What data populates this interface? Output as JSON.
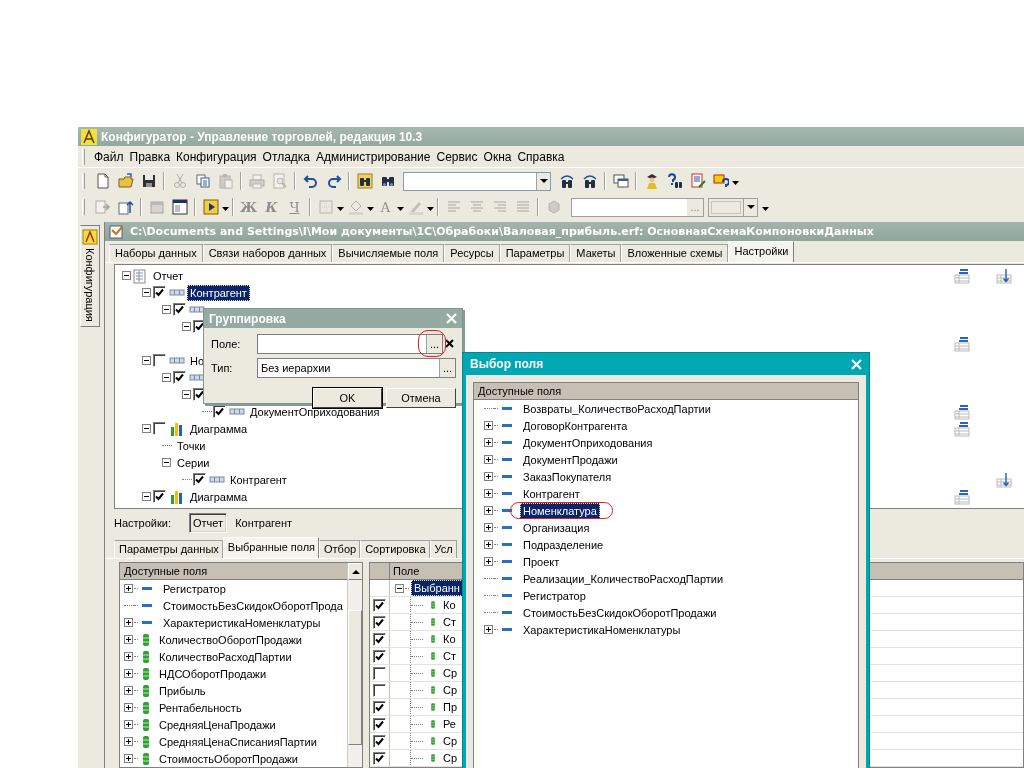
{
  "app_window": {
    "title": "Конфигуратор - Управление торговлей, редакция 10.3"
  },
  "menu": [
    "Файл",
    "Правка",
    "Конфигурация",
    "Отладка",
    "Администрирование",
    "Сервис",
    "Окна",
    "Справка"
  ],
  "toolbars": [
    [
      {
        "kind": "new",
        "disabled": false
      },
      {
        "kind": "open",
        "disabled": false
      },
      {
        "kind": "save",
        "disabled": false
      },
      {
        "kind": "sep"
      },
      {
        "kind": "cut",
        "disabled": true
      },
      {
        "kind": "copy",
        "disabled": false
      },
      {
        "kind": "paste",
        "disabled": true
      },
      {
        "kind": "sep"
      },
      {
        "kind": "print",
        "disabled": true
      },
      {
        "kind": "preview",
        "disabled": true
      },
      {
        "kind": "sep"
      },
      {
        "kind": "undo",
        "disabled": false
      },
      {
        "kind": "redo",
        "disabled": false
      },
      {
        "kind": "sep"
      },
      {
        "kind": "folder-binoculars",
        "disabled": false
      },
      {
        "kind": "binoculars",
        "disabled": false
      },
      {
        "kind": "combo"
      },
      {
        "kind": "binoculars-back",
        "disabled": false
      },
      {
        "kind": "binoculars-forward",
        "disabled": false
      },
      {
        "kind": "sep"
      },
      {
        "kind": "windows",
        "disabled": false
      },
      {
        "kind": "sep"
      },
      {
        "kind": "figure",
        "disabled": false
      },
      {
        "kind": "help-search",
        "disabled": false
      },
      {
        "kind": "doc-edit",
        "disabled": false
      },
      {
        "kind": "help-badge",
        "disabled": false
      },
      {
        "kind": "more"
      }
    ],
    [
      {
        "kind": "doc-arrow",
        "disabled": true
      },
      {
        "kind": "doc-arrow-up",
        "disabled": false
      },
      {
        "kind": "sep"
      },
      {
        "kind": "module",
        "disabled": true
      },
      {
        "kind": "form",
        "disabled": false
      },
      {
        "kind": "sep"
      },
      {
        "kind": "run",
        "disabled": false,
        "dropdown": true
      },
      {
        "kind": "sep"
      },
      {
        "kind": "bold",
        "label": "Ж",
        "disabled": true
      },
      {
        "kind": "italic",
        "label": "К",
        "disabled": true
      },
      {
        "kind": "underline",
        "label": "Ч",
        "disabled": true
      },
      {
        "kind": "sep"
      },
      {
        "kind": "borders",
        "disabled": true,
        "dropdown": true
      },
      {
        "kind": "fill",
        "disabled": true,
        "dropdown": true
      },
      {
        "kind": "font-color",
        "label": "A",
        "disabled": true,
        "dropdown": true
      },
      {
        "kind": "pen",
        "disabled": true,
        "dropdown": true
      },
      {
        "kind": "sep"
      },
      {
        "kind": "align-left",
        "disabled": true
      },
      {
        "kind": "align-center",
        "disabled": true
      },
      {
        "kind": "align-right",
        "disabled": true
      },
      {
        "kind": "justify",
        "disabled": true
      },
      {
        "kind": "sep"
      },
      {
        "kind": "cube",
        "disabled": true
      },
      {
        "kind": "field",
        "button": "..."
      },
      {
        "kind": "color"
      },
      {
        "kind": "more"
      }
    ]
  ],
  "side_panel": {
    "tab": "Конфигурация"
  },
  "document": {
    "title": "C:\\Documents and Settings\\I\\Мои документы\\1С\\Обрабоки\\Валовая_прибыль.erf: ОсновнаяСхемаКомпоновкиДанных",
    "tabs": [
      {
        "label": "Наборы данных",
        "selected": false
      },
      {
        "label": "Связи наборов данных",
        "selected": false
      },
      {
        "label": "Вычисляемые поля",
        "selected": false
      },
      {
        "label": "Ресурсы",
        "selected": false
      },
      {
        "label": "Параметры",
        "selected": false
      },
      {
        "label": "Макеты",
        "selected": false
      },
      {
        "label": "Вложенные схемы",
        "selected": false
      },
      {
        "label": "Настройки",
        "selected": true
      }
    ],
    "structure": [
      {
        "label": "Отчет",
        "kind": "report",
        "selected": false,
        "expanded": true,
        "marks": [
          {
            "kind": "table"
          },
          {
            "kind": "arrow"
          }
        ],
        "children": [
          {
            "label": "Контрагент",
            "kind": "field",
            "checked": true,
            "selected": true,
            "expanded": true,
            "children": [
              {
                "kind": "field",
                "checked": true,
                "expanded": true,
                "children": [
                  {
                    "checked": true,
                    "expanded": true,
                    "children": [
                      {
                        "marks": [
                          {
                            "kind": "table"
                          }
                        ]
                      }
                    ]
                  }
                ]
              }
            ]
          },
          {
            "label": "Но",
            "kind": "field",
            "checked": false,
            "selected": false,
            "expanded": true,
            "children": [
              {
                "kind": "field",
                "checked": true,
                "expanded": true,
                "children": [
                  {
                    "checked": true,
                    "expanded": true,
                    "children": [
                      {
                        "label": "ДокументОприходования",
                        "kind": "field",
                        "checked": true,
                        "selected": false,
                        "marks": [
                          {
                            "kind": "table"
                          }
                        ]
                      }
                    ]
                  }
                ]
              }
            ]
          },
          {
            "label": "Диаграмма",
            "kind": "chart",
            "checked": false,
            "selected": false,
            "expanded": true,
            "marks": [
              {
                "kind": "table"
              }
            ],
            "children": [
              {
                "label": "Точки",
                "selected": false
              },
              {
                "label": "Серии",
                "selected": false,
                "expanded": true,
                "children": [
                  {
                    "label": "Контрагент",
                    "kind": "field",
                    "checked": true,
                    "selected": false,
                    "marks": [
                      {
                        "kind": "arrow"
                      }
                    ]
                  }
                ]
              }
            ]
          },
          {
            "label": "Диаграмма",
            "kind": "chart",
            "checked": true,
            "selected": false,
            "expanded": true,
            "marks": [
              {
                "kind": "table"
              }
            ]
          }
        ]
      }
    ],
    "settings_bar": {
      "label": "Настройки:",
      "buttons": [
        {
          "label": "Отчет",
          "selected": true
        },
        {
          "label": "Контрагент",
          "selected": false
        }
      ]
    },
    "settings_tabs": [
      {
        "label": "Параметры данных",
        "selected": false
      },
      {
        "label": "Выбранные поля",
        "selected": true
      },
      {
        "label": "Отбор",
        "selected": false
      },
      {
        "label": "Сортировка",
        "selected": false
      },
      {
        "label": "Усл",
        "selected": false
      }
    ],
    "available_fields": {
      "header": "Доступные поля",
      "items": [
        {
          "label": "Регистратор",
          "kind": "field",
          "expanded": false
        },
        {
          "label": "СтоимостьБезСкидокОборотПрода",
          "kind": "field"
        },
        {
          "label": "ХарактеристикаНоменклатуры",
          "kind": "field",
          "expanded": false
        },
        {
          "label": "КоличествоОборотПродажи",
          "kind": "resource",
          "expanded": false
        },
        {
          "label": "КоличествоРасходПартии",
          "kind": "resource",
          "expanded": false
        },
        {
          "label": "НДСОборотПродажи",
          "kind": "resource",
          "expanded": false
        },
        {
          "label": "Прибыль",
          "kind": "resource",
          "expanded": false
        },
        {
          "label": "Рентабельность",
          "kind": "resource",
          "expanded": false
        },
        {
          "label": "СредняяЦенаПродажи",
          "kind": "resource",
          "expanded": false
        },
        {
          "label": "СредняяЦенаСписанияПартии",
          "kind": "resource",
          "expanded": false
        },
        {
          "label": "СтоимостьОборотПродажи",
          "kind": "resource",
          "expanded": false
        }
      ]
    },
    "selected_fields": {
      "column": "Поле",
      "rows": [
        {
          "label": "Выбранн",
          "selected": true,
          "expanded": true,
          "children": [
            {
              "label": "Ко",
              "checked": true,
              "selected": false
            },
            {
              "label": "Ст",
              "checked": true,
              "selected": false
            },
            {
              "label": "Ко",
              "checked": true,
              "selected": false
            },
            {
              "label": "Ст",
              "checked": true,
              "selected": false
            },
            {
              "label": "Ср",
              "checked": false,
              "selected": false
            },
            {
              "label": "Ср",
              "checked": false,
              "selected": false
            },
            {
              "label": "Пр",
              "checked": true,
              "selected": false
            },
            {
              "label": "Ре",
              "checked": true,
              "selected": false
            },
            {
              "label": "Ср",
              "checked": true,
              "selected": false
            },
            {
              "label": "Ср",
              "checked": true,
              "selected": false
            }
          ]
        }
      ]
    }
  },
  "grouping_dialog": {
    "title": "Группировка",
    "field": {
      "label": "Поле:",
      "picker": "...",
      "highlighted": true
    },
    "type": {
      "label": "Тип:",
      "value": "Без иерархии",
      "picker": "..."
    },
    "buttons": [
      {
        "label": "OK",
        "default": true
      },
      {
        "label": "Отмена",
        "default": false
      }
    ]
  },
  "field_picker": {
    "title": "Выбор поля",
    "header": "Доступные поля",
    "items": [
      {
        "label": "Возвраты_КоличествоРасходПартии",
        "selected": false,
        "highlighted": false
      },
      {
        "label": "ДоговорКонтрагента",
        "expanded": false,
        "selected": false,
        "highlighted": false
      },
      {
        "label": "ДокументОприходования",
        "expanded": false,
        "selected": false,
        "highlighted": false
      },
      {
        "label": "ДокументПродажи",
        "expanded": false,
        "selected": false,
        "highlighted": false
      },
      {
        "label": "ЗаказПокупателя",
        "expanded": false,
        "selected": false,
        "highlighted": false
      },
      {
        "label": "Контрагент",
        "expanded": false,
        "selected": false,
        "highlighted": false
      },
      {
        "label": "Номенклатура",
        "expanded": false,
        "selected": true,
        "highlighted": true
      },
      {
        "label": "Организация",
        "expanded": false,
        "selected": false,
        "highlighted": false
      },
      {
        "label": "Подразделение",
        "expanded": false,
        "selected": false,
        "highlighted": false
      },
      {
        "label": "Проект",
        "expanded": false,
        "selected": false,
        "highlighted": false
      },
      {
        "label": "Реализации_КоличествоРасходПартии",
        "selected": false,
        "highlighted": false
      },
      {
        "label": "Регистратор",
        "selected": false,
        "highlighted": false
      },
      {
        "label": "СтоимостьБезСкидокОборотПродажи",
        "selected": false,
        "highlighted": false
      },
      {
        "label": "ХарактеристикаНоменклатуры",
        "expanded": false,
        "selected": false,
        "highlighted": false
      }
    ]
  }
}
